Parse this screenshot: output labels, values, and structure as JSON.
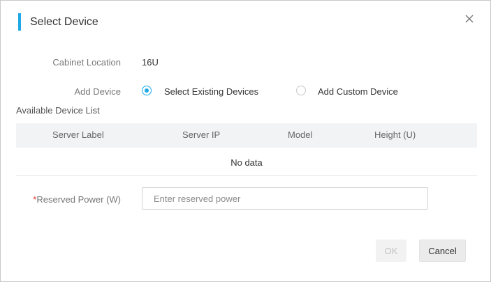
{
  "dialog": {
    "partial_top_text": "...",
    "title": "Select Device",
    "close_icon": "close-icon"
  },
  "form": {
    "cabinet_location_label": "Cabinet Location",
    "cabinet_location_value": "16U",
    "add_device_label": "Add Device",
    "add_device_options": [
      {
        "label": "Select Existing Devices",
        "selected": true
      },
      {
        "label": "Add Custom Device",
        "selected": false
      }
    ],
    "reserved_power_required_mark": "*",
    "reserved_power_label": "Reserved Power (W)",
    "reserved_power_placeholder": "Enter reserved power",
    "reserved_power_value": ""
  },
  "device_list": {
    "title": "Available Device List",
    "columns": [
      "Server Label",
      "Server IP",
      "Model",
      "Height (U)"
    ],
    "rows": [],
    "empty_text": "No data"
  },
  "footer": {
    "ok_label": "OK",
    "ok_disabled": true,
    "cancel_label": "Cancel"
  },
  "colors": {
    "accent": "#1fa9e6",
    "required": "#e0362c",
    "table_header_bg": "#f2f3f5"
  }
}
